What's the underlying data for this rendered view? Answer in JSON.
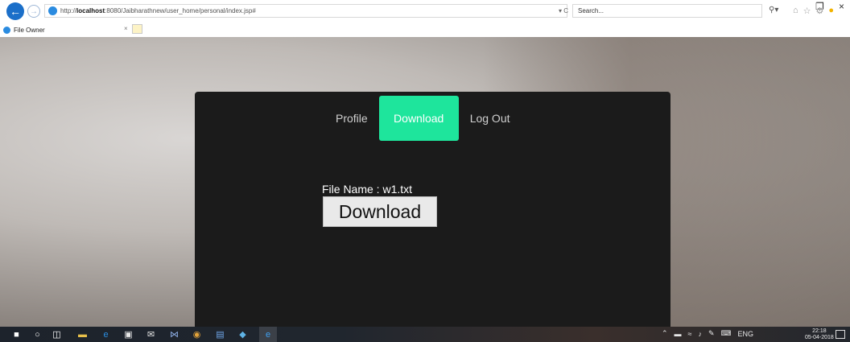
{
  "browser": {
    "url_prefix": "http://",
    "url_host": "localhost",
    "url_rest": ":8080/Jaibharathnew/user_home/personal/index.jsp#",
    "refresh_glyph": "▾ C",
    "search_placeholder": "Search...",
    "tab_title": "File Owner",
    "tab_close": "×"
  },
  "nav": {
    "items": [
      {
        "label": "Profile",
        "active": false
      },
      {
        "label": "Download",
        "active": true
      },
      {
        "label": "Log Out",
        "active": false
      }
    ]
  },
  "main": {
    "file_label": "File Name : w1.txt",
    "download_button": "Download"
  },
  "taskbar": {
    "language": "ENG",
    "time": "22:18",
    "date": "05-04-2018"
  },
  "colors": {
    "accent": "#1ee59c",
    "panel": "#1b1b1b",
    "browser_blue": "#1b6fc9"
  }
}
